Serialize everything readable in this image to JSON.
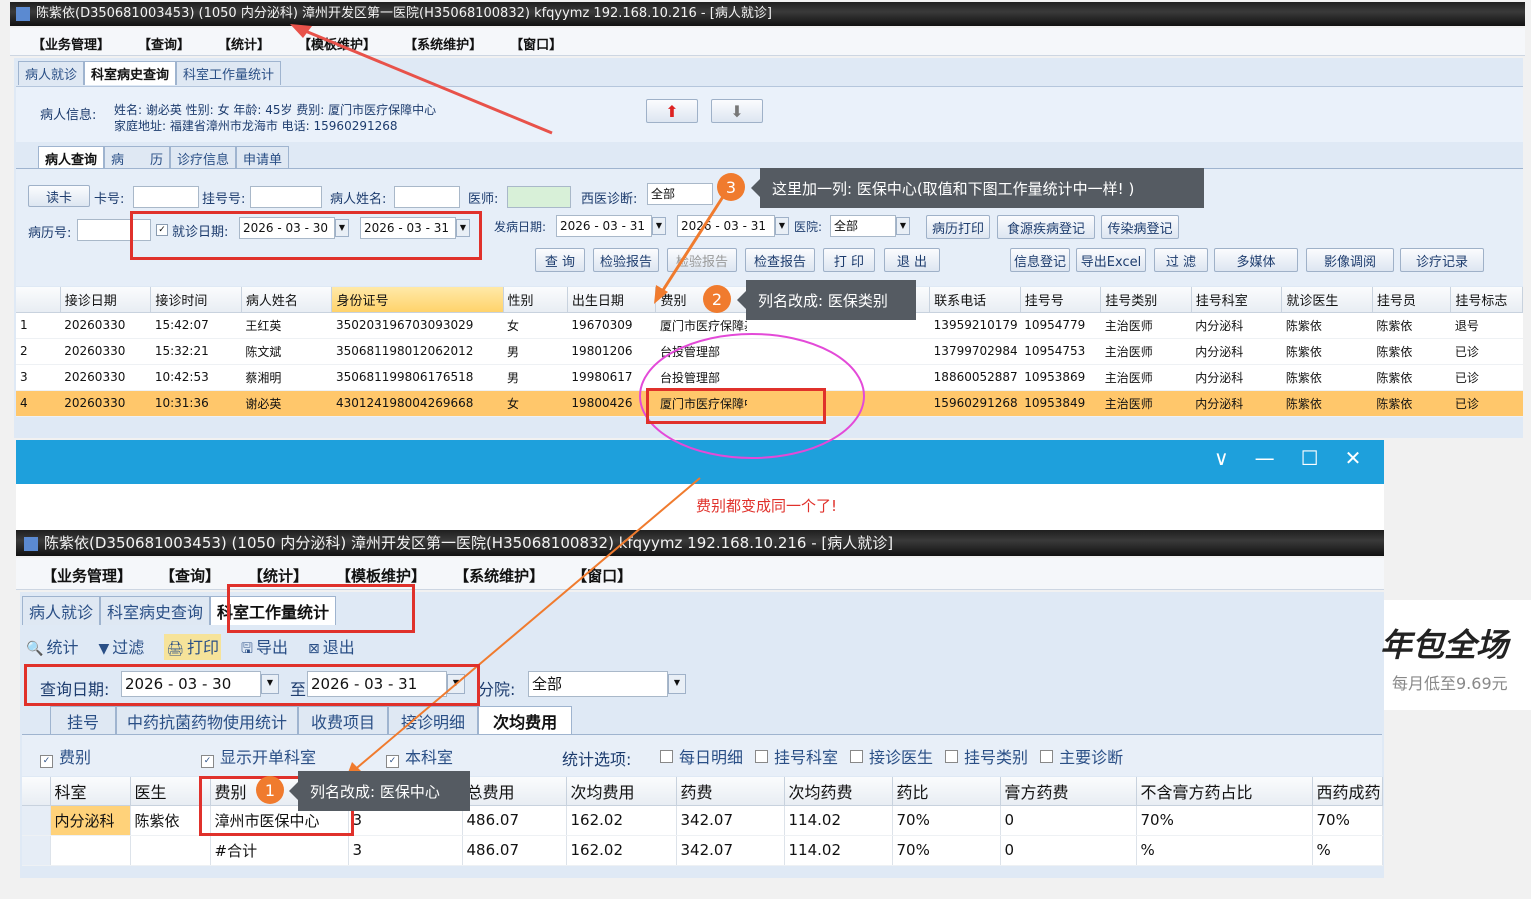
{
  "top": {
    "title": "陈紫依(D350681003453) (1050 内分泌科) 漳州开发区第一医院(H35068100832) kfqyymz 192.168.10.216 - [病人就诊]",
    "menu": [
      "【业务管理】",
      "【查询】",
      "【统计】",
      "【模板维护】",
      "【系统维护】",
      "【窗口】"
    ],
    "tabs": [
      "病人就诊",
      "科室病史查询",
      "科室工作量统计"
    ],
    "patient_info_label": "病人信息:",
    "patient_line1": "姓名: 谢必英   性别: 女   年龄: 45岁   费别: 厦门市医疗保障中心",
    "patient_line2": "家庭地址: 福建省漳州市龙海市   电话: 15960291268",
    "subtabs": [
      "病人查询",
      "病　　历",
      "诊疗信息",
      "申请单"
    ],
    "labels": {
      "card": "卡号:",
      "reg_no": "挂号号:",
      "patient_name": "病人姓名:",
      "doctor": "医师:",
      "diagnosis": "西医诊断:",
      "record_no": "病历号:",
      "visit_date": "就诊日期:",
      "onset_date": "发病日期:",
      "hospital": "医院:"
    },
    "read_card": "读卡",
    "diagnosis_value": "全部",
    "hospital_value": "全部",
    "visit_from": "2026 - 03 - 30",
    "visit_to": "2026 - 03 - 31",
    "onset_from": "2026 - 03 - 31",
    "onset_to": "2026 - 03 - 31",
    "buttons_row1": [
      "病历打印",
      "食源疾病登记",
      "传染病登记"
    ],
    "buttons_row2": [
      "查 询",
      "检验报告",
      "检验报告",
      "检查报告",
      "打 印",
      "退 出",
      "信息登记",
      "导出Excel",
      "过 滤",
      "多媒体",
      "影像调阅",
      "诊疗记录"
    ],
    "columns": [
      "",
      "接诊日期",
      "接诊时间",
      "病人姓名",
      "身份证号",
      "性别",
      "出生日期",
      "费别",
      "",
      "联系电话",
      "挂号号",
      "挂号类别",
      "挂号科室",
      "就诊医生",
      "挂号员",
      "挂号标志"
    ],
    "rows": [
      [
        "1",
        "20260330",
        "15:42:07",
        "王红英",
        "350203196703093029",
        "女",
        "19670309",
        "厦门市医疗保障基金...",
        "",
        "13959210179",
        "10954779",
        "主治医师",
        "内分泌科",
        "陈紫依",
        "陈紫依",
        "退号"
      ],
      [
        "2",
        "20260330",
        "15:32:21",
        "陈文斌",
        "350681198012062012",
        "男",
        "19801206",
        "台投管理部",
        "",
        "13799702984",
        "10954753",
        "主治医师",
        "内分泌科",
        "陈紫依",
        "陈紫依",
        "已诊"
      ],
      [
        "3",
        "20260330",
        "10:42:53",
        "蔡湘明",
        "350681199806176518",
        "男",
        "19980617",
        "台投管理部",
        "",
        "18860052887",
        "10953869",
        "主治医师",
        "内分泌科",
        "陈紫依",
        "陈紫依",
        "已诊"
      ],
      [
        "4",
        "20260330",
        "10:31:36",
        "谢必英",
        "430124198004269668",
        "女",
        "19800426",
        "厦门市医疗保障中心",
        "",
        "15960291268",
        "10953849",
        "主治医师",
        "内分泌科",
        "陈紫依",
        "陈紫依",
        "已诊"
      ]
    ]
  },
  "bottom": {
    "title": "陈紫依(D350681003453) (1050 内分泌科) 漳州开发区第一医院(H35068100832) kfqyymz 192.168.10.216 - [病人就诊]",
    "menu": [
      "【业务管理】",
      "【查询】",
      "【统计】",
      "【模板维护】",
      "【系统维护】",
      "【窗口】"
    ],
    "tabs": [
      "病人就诊",
      "科室病史查询",
      "科室工作量统计"
    ],
    "toolbar": [
      "统计",
      "过滤",
      "打印",
      "导出",
      "退出"
    ],
    "query_date_label": "查询日期:",
    "date_from": "2026 - 03 - 30",
    "to_label": "至",
    "date_to": "2026 - 03 - 31",
    "branch_label": "分院:",
    "branch_value": "全部",
    "subtabs": [
      "挂号",
      "中药抗菌药物使用统计",
      "收费项目",
      "接诊明细",
      "次均费用"
    ],
    "checks": [
      "费别",
      "显示开单科室",
      "本科室"
    ],
    "stat_label": "统计选项:",
    "stat_checks": [
      "每日明细",
      "挂号科室",
      "接诊医生",
      "挂号类别",
      "主要诊断"
    ],
    "columns": [
      "",
      "科室",
      "医生",
      "费别",
      "",
      "总费用",
      "次均费用",
      "药费",
      "次均药费",
      "药比",
      "膏方药费",
      "不含膏方药占比",
      "西药成药"
    ],
    "rows": [
      [
        "",
        "内分泌科",
        "陈紫依",
        "漳州市医保中心",
        "3",
        "486.07",
        "162.02",
        "342.07",
        "114.02",
        "70%",
        "0",
        "70%",
        "70%"
      ],
      [
        "",
        "",
        "",
        "#合计",
        "3",
        "486.07",
        "162.02",
        "342.07",
        "114.02",
        "70%",
        "0",
        "%",
        "%"
      ]
    ]
  },
  "annotations": {
    "c1": "列名改成: 医保中心",
    "c2": "列名改成: 医保类别",
    "c3": "这里加一列: 医保中心(取值和下图工作量统计中一样! )",
    "note": "费别都变成同一个了!",
    "n1": "1",
    "n2": "2",
    "n3": "3"
  },
  "ad": {
    "line1": "年包全场",
    "line2": "每月低至9.69元"
  },
  "window_controls": [
    "∨",
    "—",
    "☐",
    "✕"
  ]
}
